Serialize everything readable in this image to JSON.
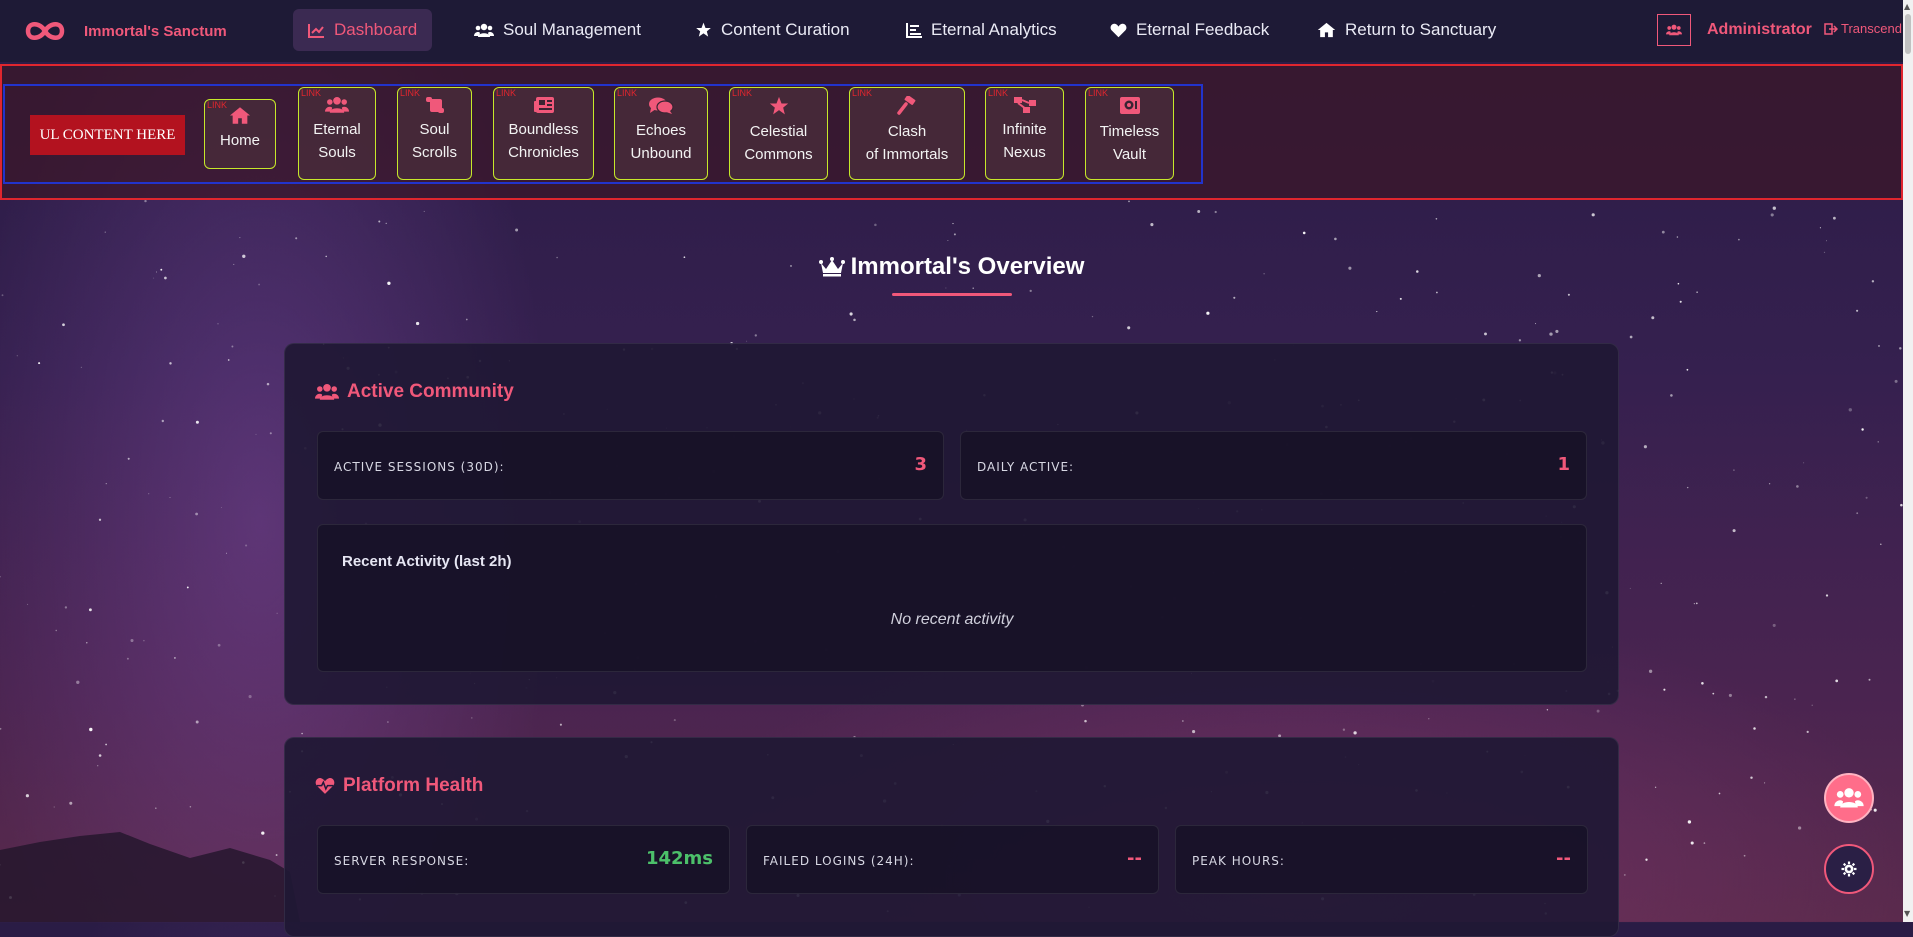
{
  "app": {
    "title": "Immortal's Sanctum",
    "accent_color": "#f0587a",
    "success_color": "#4cc06a"
  },
  "nav": {
    "items": [
      {
        "label": "Dashboard",
        "icon": "chart-line-icon",
        "active": true
      },
      {
        "label": "Soul Management",
        "icon": "users-icon"
      },
      {
        "label": "Content Curation",
        "icon": "star-icon"
      },
      {
        "label": "Eternal Analytics",
        "icon": "bar-chart-icon"
      },
      {
        "label": "Eternal Feedback",
        "icon": "heart-icon"
      },
      {
        "label": "Return to Sanctuary",
        "icon": "home-icon"
      }
    ],
    "user_label": "Administrator",
    "logout_label": "Transcend"
  },
  "ul_strip": {
    "placeholder": "UL CONTENT HERE",
    "tag": "LINK",
    "items": [
      {
        "line1": "Home",
        "line2": "",
        "icon": "home-icon"
      },
      {
        "line1": "Eternal",
        "line2": "Souls",
        "icon": "users-icon"
      },
      {
        "line1": "Soul",
        "line2": "Scrolls",
        "icon": "scroll-icon"
      },
      {
        "line1": "Boundless",
        "line2": "Chronicles",
        "icon": "newspaper-icon"
      },
      {
        "line1": "Echoes",
        "line2": "Unbound",
        "icon": "comments-icon"
      },
      {
        "line1": "Celestial",
        "line2": "Commons",
        "icon": "star-icon"
      },
      {
        "line1": "Clash",
        "line2": "of Immortals",
        "icon": "gavel-icon"
      },
      {
        "line1": "Infinite",
        "line2": "Nexus",
        "icon": "sitemap-icon"
      },
      {
        "line1": "Timeless",
        "line2": "Vault",
        "icon": "vault-icon"
      }
    ]
  },
  "overview": {
    "title": "Immortal's Overview",
    "icon": "crown-icon"
  },
  "community": {
    "title": "Active Community",
    "icon": "users-icon",
    "stats": [
      {
        "label": "ACTIVE SESSIONS (30D):",
        "value": "3"
      },
      {
        "label": "DAILY ACTIVE:",
        "value": "1"
      }
    ],
    "activity_title": "Recent Activity (last 2h)",
    "activity_empty": "No recent activity"
  },
  "health": {
    "title": "Platform Health",
    "icon": "heartbeat-icon",
    "stats": [
      {
        "label": "SERVER RESPONSE:",
        "value": "142ms",
        "status": "good"
      },
      {
        "label": "FAILED LOGINS (24H):",
        "value": "--"
      },
      {
        "label": "PEAK HOURS:",
        "value": "--"
      }
    ]
  },
  "fabs": {
    "users_icon": "users-icon",
    "settings_icon": "gear-icon"
  }
}
